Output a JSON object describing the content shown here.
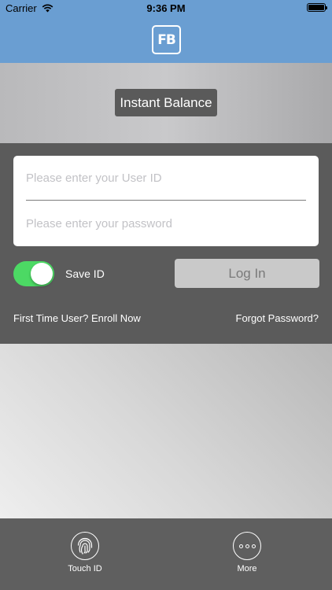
{
  "status_bar": {
    "carrier": "Carrier",
    "time": "9:36 PM"
  },
  "header": {
    "logo_text": "FB"
  },
  "instant_balance": {
    "label": "Instant Balance"
  },
  "login_form": {
    "user_id_placeholder": "Please enter your User ID",
    "password_placeholder": "Please enter your password",
    "save_id_label": "Save ID",
    "save_id_enabled": true,
    "login_label": "Log In",
    "enroll_label": "First Time User? Enroll Now",
    "forgot_label": "Forgot Password?"
  },
  "tab_bar": {
    "items": [
      {
        "label": "Touch ID",
        "icon": "fingerprint-icon"
      },
      {
        "label": "More",
        "icon": "more-icon"
      }
    ]
  },
  "colors": {
    "header": "#6a9ed2",
    "toggle_on": "#4cd964",
    "panel": "#5b5b5b"
  }
}
